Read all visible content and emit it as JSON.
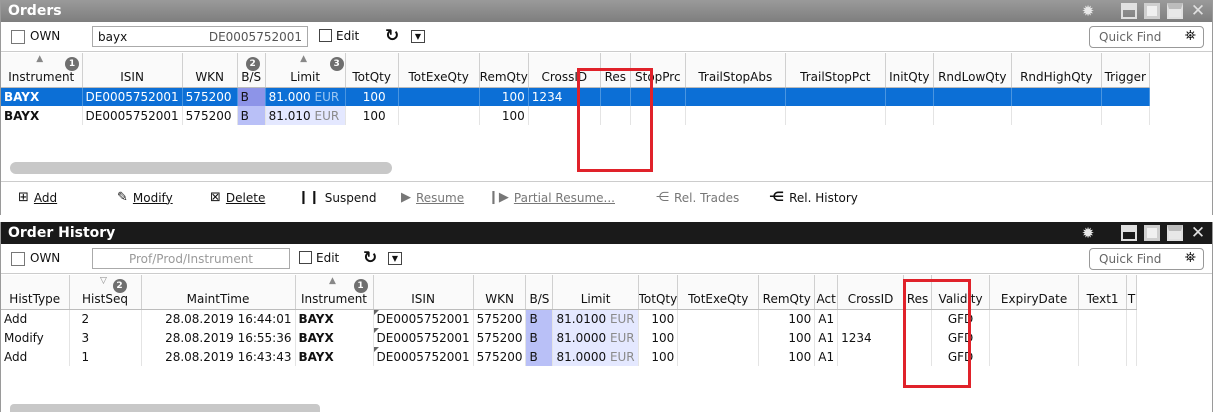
{
  "orders": {
    "title": "Orders",
    "own_label": "OWN",
    "search_value": "bayx",
    "search_isin": "DE0005752001",
    "edit_label": "Edit",
    "quickfind_label": "Quick Find",
    "columns": [
      "Instrument",
      "ISIN",
      "WKN",
      "B/S",
      "Limit",
      "TotQty",
      "TotExeQty",
      "RemQty",
      "CrossID",
      "Res",
      "StopPrc",
      "TrailStopAbs",
      "TrailStopPct",
      "InitQty",
      "RndLowQty",
      "RndHighQty",
      "Trigger"
    ],
    "badges": {
      "instrument": "1",
      "bs": "2",
      "limit": "3"
    },
    "rows": [
      {
        "instrument": "BAYX",
        "isin": "DE0005752001",
        "wkn": "575200",
        "bs": "B",
        "limit": "81.000",
        "currency": "EUR",
        "totqty": "100",
        "totexeqty": "",
        "remqty": "100",
        "crossid": "1234"
      },
      {
        "instrument": "BAYX",
        "isin": "DE0005752001",
        "wkn": "575200",
        "bs": "B",
        "limit": "81.010",
        "currency": "EUR",
        "totqty": "100",
        "totexeqty": "",
        "remqty": "100",
        "crossid": ""
      }
    ],
    "actions": {
      "add": "Add",
      "modify": "Modify",
      "delete": "Delete",
      "suspend": "Suspend",
      "resume": "Resume",
      "partial_resume": "Partial Resume...",
      "rel_trades": "Rel. Trades",
      "rel_history": "Rel. History"
    }
  },
  "history": {
    "title": "Order History",
    "own_label": "OWN",
    "search_placeholder": "Prof/Prod/Instrument",
    "edit_label": "Edit",
    "quickfind_label": "Quick Find",
    "columns": [
      "HistType",
      "HistSeq",
      "MaintTime",
      "Instrument",
      "ISIN",
      "WKN",
      "B/S",
      "Limit",
      "TotQty",
      "TotExeQty",
      "RemQty",
      "Act",
      "CrossID",
      "Res",
      "Validity",
      "ExpiryDate",
      "Text1",
      "T"
    ],
    "badges": {
      "histseq": "2",
      "instrument": "1"
    },
    "rows": [
      {
        "histtype": "Add",
        "histseq": "2",
        "mainttime": "28.08.2019 16:44:01",
        "instrument": "BAYX",
        "isin": "DE0005752001",
        "wkn": "575200",
        "bs": "B",
        "limit": "81.0100",
        "currency": "EUR",
        "totqty": "100",
        "remqty": "100",
        "act": "A1",
        "crossid": "",
        "validity": "GFD"
      },
      {
        "histtype": "Modify",
        "histseq": "3",
        "mainttime": "28.08.2019 16:55:36",
        "instrument": "BAYX",
        "isin": "DE0005752001",
        "wkn": "575200",
        "bs": "B",
        "limit": "81.0000",
        "currency": "EUR",
        "totqty": "100",
        "remqty": "100",
        "act": "A1",
        "crossid": "1234",
        "validity": "GFD"
      },
      {
        "histtype": "Add",
        "histseq": "1",
        "mainttime": "28.08.2019 16:43:43",
        "instrument": "BAYX",
        "isin": "DE0005752001",
        "wkn": "575200",
        "bs": "B",
        "limit": "81.0000",
        "currency": "EUR",
        "totqty": "100",
        "remqty": "100",
        "act": "A1",
        "crossid": "",
        "validity": "GFD"
      }
    ]
  },
  "colors": {
    "selection": "#0c6fd6",
    "highlight_box": "#e0222a",
    "buy_cell": "#b9c0f7"
  }
}
